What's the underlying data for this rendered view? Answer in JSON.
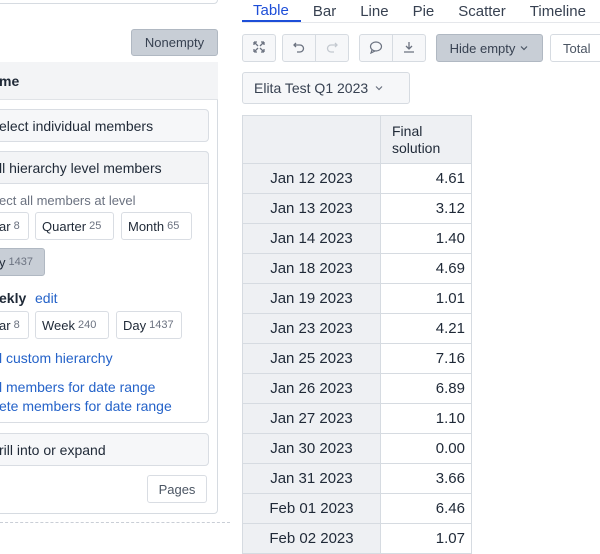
{
  "left_panel": {
    "nonempty_label": "Nonempty",
    "title": "me",
    "select_individual": "elect individual members",
    "all_hierarchy": "ll hierarchy level members",
    "select_all_label": "ect all members at level",
    "row1_chips": [
      {
        "label": "ar",
        "count": "8",
        "selected": false
      },
      {
        "label": "Quarter",
        "count": "25",
        "selected": false
      },
      {
        "label": "Month",
        "count": "65",
        "selected": false
      }
    ],
    "day_chip": {
      "label": "y",
      "count": "1437",
      "selected": true
    },
    "weekly_label": "ekly",
    "edit_link": "edit",
    "row2_chips": [
      {
        "label": "ar",
        "count": "8",
        "selected": false
      },
      {
        "label": "Week",
        "count": "240",
        "selected": false
      },
      {
        "label": "Day",
        "count": "1437",
        "selected": false
      }
    ],
    "custom_hierarchy": "l custom hierarchy",
    "members_date_range": "l members for date range",
    "delete_members_date_range": "ete members for date range",
    "drill_into": "rill into or expand",
    "pages_label": "Pages"
  },
  "tabs": [
    "Table",
    "Bar",
    "Line",
    "Pie",
    "Scatter",
    "Timeline"
  ],
  "active_tab": "Table",
  "toolbar": {
    "icons": [
      "expand-icon",
      "undo-icon",
      "redo-icon",
      "comment-icon",
      "download-icon"
    ],
    "hide_empty_label": "Hide empty",
    "total_label": "Total"
  },
  "page_selector": {
    "value": "Elita Test Q1 2023"
  },
  "table": {
    "column_header": "Final solution",
    "rows": [
      {
        "date": "Jan 12 2023",
        "value": "4.61"
      },
      {
        "date": "Jan 13 2023",
        "value": "3.12"
      },
      {
        "date": "Jan 14 2023",
        "value": "1.40"
      },
      {
        "date": "Jan 18 2023",
        "value": "4.69"
      },
      {
        "date": "Jan 19 2023",
        "value": "1.01"
      },
      {
        "date": "Jan 23 2023",
        "value": "4.21"
      },
      {
        "date": "Jan 25 2023",
        "value": "7.16"
      },
      {
        "date": "Jan 26 2023",
        "value": "6.89"
      },
      {
        "date": "Jan 27 2023",
        "value": "1.10"
      },
      {
        "date": "Jan 30 2023",
        "value": "0.00"
      },
      {
        "date": "Jan 31 2023",
        "value": "3.66"
      },
      {
        "date": "Feb 01 2023",
        "value": "6.46"
      },
      {
        "date": "Feb 02 2023",
        "value": "1.07"
      }
    ]
  }
}
